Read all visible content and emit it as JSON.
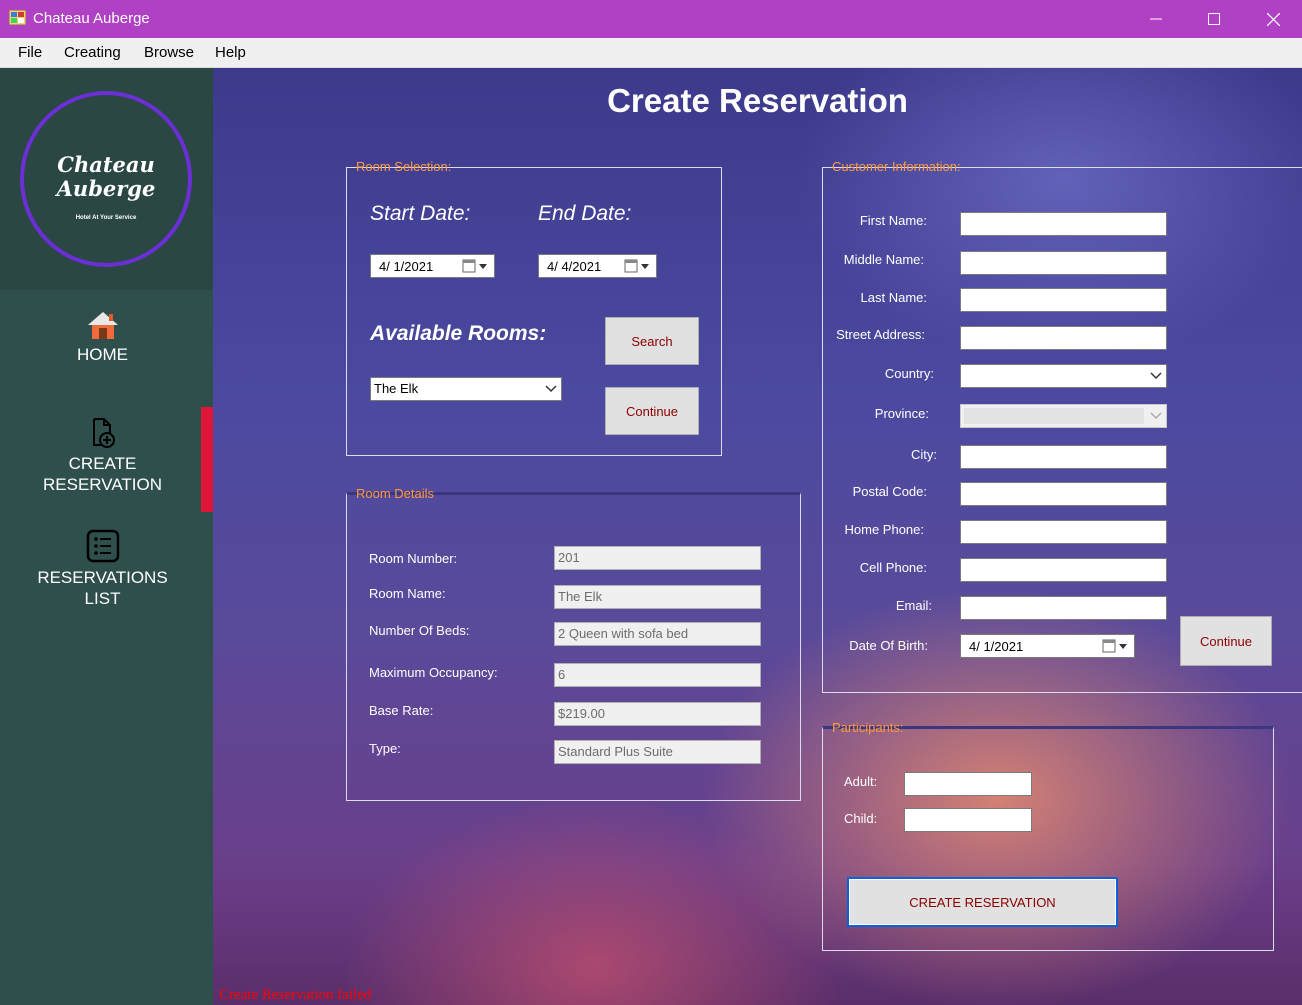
{
  "window": {
    "title": "Chateau Auberge"
  },
  "menu": [
    "File",
    "Creating",
    "Browse",
    "Help"
  ],
  "sidebar": {
    "logo": {
      "line1": "Chateau",
      "line2": "Auberge",
      "tagline": "Hotel At Your Service"
    },
    "items": [
      {
        "label": "HOME",
        "icon": "home-icon"
      },
      {
        "label1": "CREATE",
        "label2": "RESERVATION",
        "icon": "add-document-icon",
        "active": true
      },
      {
        "label1": "RESERVATIONS",
        "label2": "LIST",
        "icon": "list-icon"
      }
    ],
    "active_color": "#e0153a"
  },
  "page": {
    "title": "Create Reservation"
  },
  "room_selection": {
    "group_label": "Room Selection:",
    "start_label": "Start Date:",
    "end_label": "End Date:",
    "start_value": "4/  1/2021",
    "end_value": "4/  4/2021",
    "available_label": "Available Rooms:",
    "room_value": "The Elk",
    "search_label": "Search",
    "continue_label": "Continue"
  },
  "room_details": {
    "group_label": "Room Details",
    "fields": [
      {
        "label": "Room Number:",
        "value": "201"
      },
      {
        "label": "Room Name:",
        "value": "The Elk"
      },
      {
        "label": "Number Of Beds:",
        "value": "2 Queen with sofa bed"
      },
      {
        "label": "Maximum Occupancy:",
        "value": "6"
      },
      {
        "label": "Base Rate:",
        "value": "$219.00"
      },
      {
        "label": "Type:",
        "value": "Standard Plus Suite"
      }
    ]
  },
  "customer": {
    "group_label": "Customer Information:",
    "first_name": {
      "label": "First Name:",
      "value": ""
    },
    "middle_name": {
      "label": "Middle Name:",
      "value": ""
    },
    "last_name": {
      "label": "Last Name:",
      "value": ""
    },
    "street": {
      "label": "Street Address:",
      "value": ""
    },
    "country": {
      "label": "Country:",
      "value": ""
    },
    "province": {
      "label": "Province:",
      "value": ""
    },
    "city": {
      "label": "City:",
      "value": ""
    },
    "postal": {
      "label": "Postal Code:",
      "value": ""
    },
    "home_phone": {
      "label": "Home Phone:",
      "value": ""
    },
    "cell_phone": {
      "label": "Cell Phone:",
      "value": ""
    },
    "email": {
      "label": "Email:",
      "value": ""
    },
    "dob": {
      "label": "Date Of Birth:",
      "value": "4/  1/2021"
    },
    "continue_label": "Continue"
  },
  "participants": {
    "group_label": "Participants:",
    "adult_label": "Adult:",
    "child_label": "Child:",
    "adult_value": "",
    "child_value": "",
    "create_label": "CREATE RESERVATION"
  },
  "status": {
    "message": "Create Reservation failed",
    "color": "#ff0000"
  },
  "colors": {
    "title_bar": "#b040c4",
    "sidebar": "#2f4f4c",
    "group_label": "#ff9a3c",
    "button_text": "#8b0000"
  }
}
